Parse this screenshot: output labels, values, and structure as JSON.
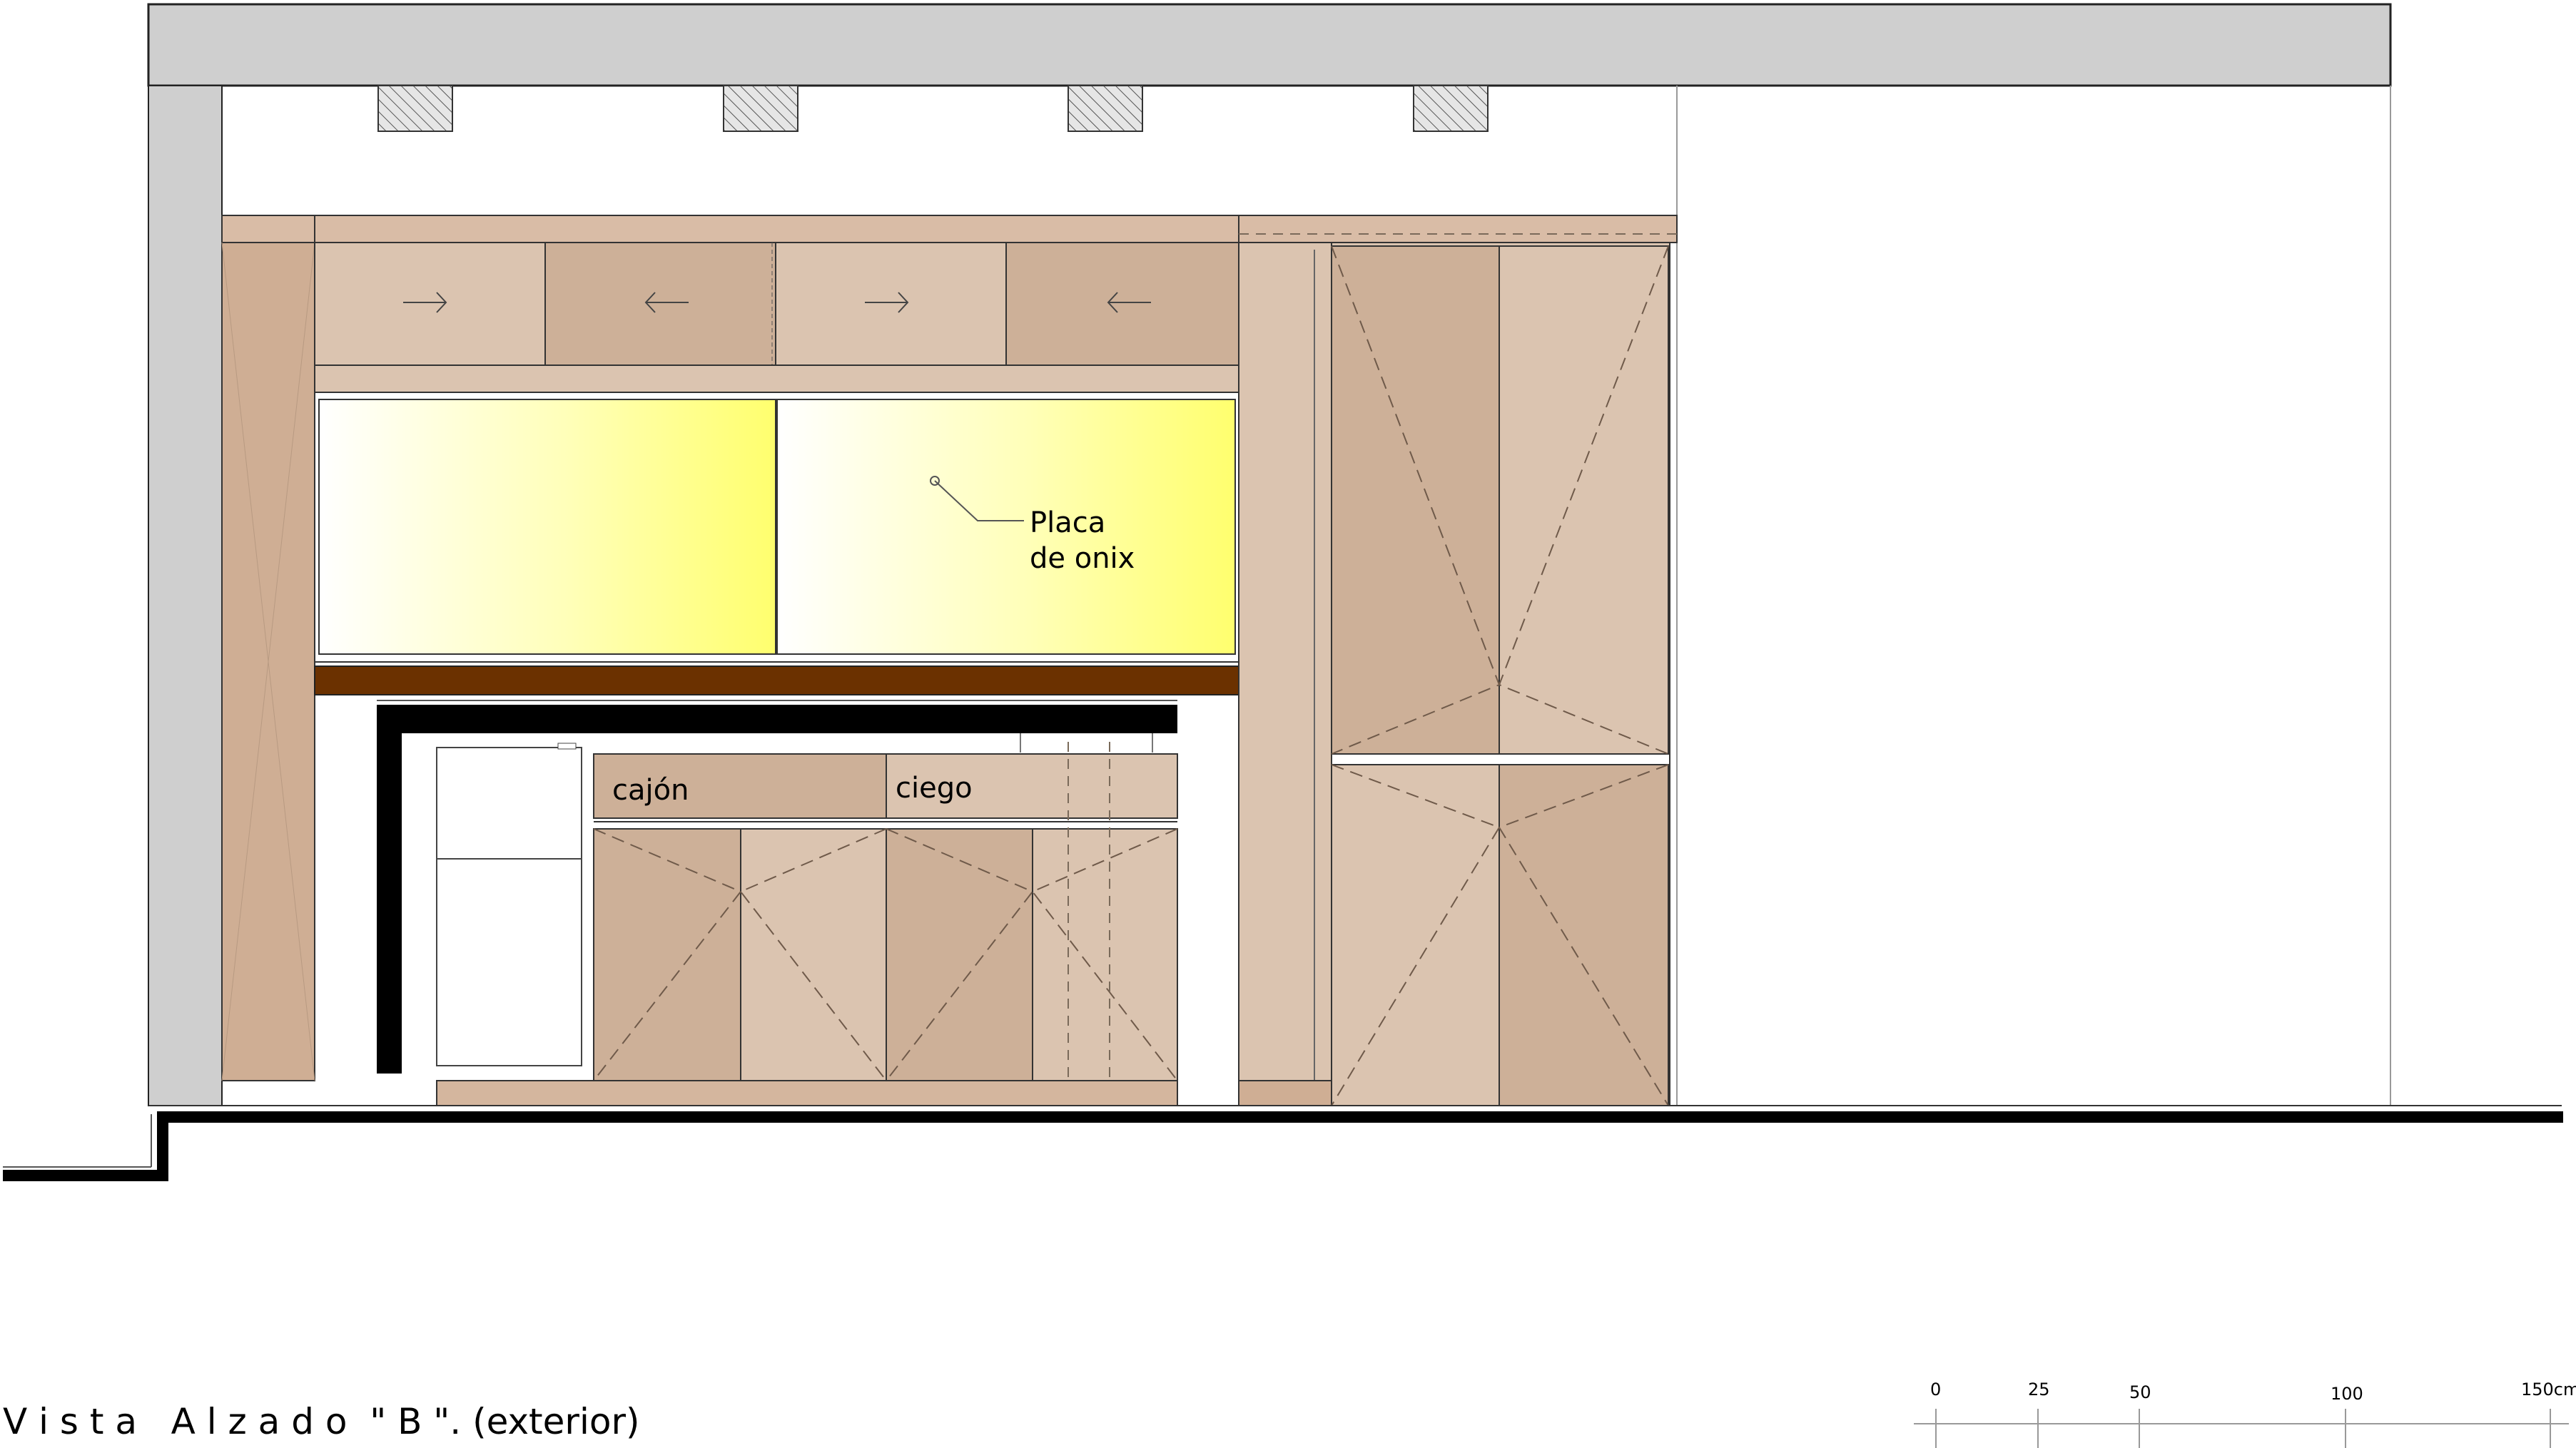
{
  "drawing": {
    "title": "V i s t a   A l z a d o  \" B \". (exterior)",
    "labels": {
      "placa_line1": "Placa",
      "placa_line2": "de onix",
      "cajon": "cajón",
      "ciego": "ciego"
    },
    "scale_bar": {
      "ticks": [
        "0",
        "25",
        "50",
        "100",
        "150cm"
      ]
    },
    "colors": {
      "wall_gray": "#cfcfcf",
      "wood_light": "#dbc4b0",
      "wood_mid": "#cdb098",
      "wood_dark": "#c9ab92",
      "walnut": "#6b3100",
      "onyx_yellow": "#ffff6e",
      "line": "#222222",
      "black": "#000000"
    }
  }
}
